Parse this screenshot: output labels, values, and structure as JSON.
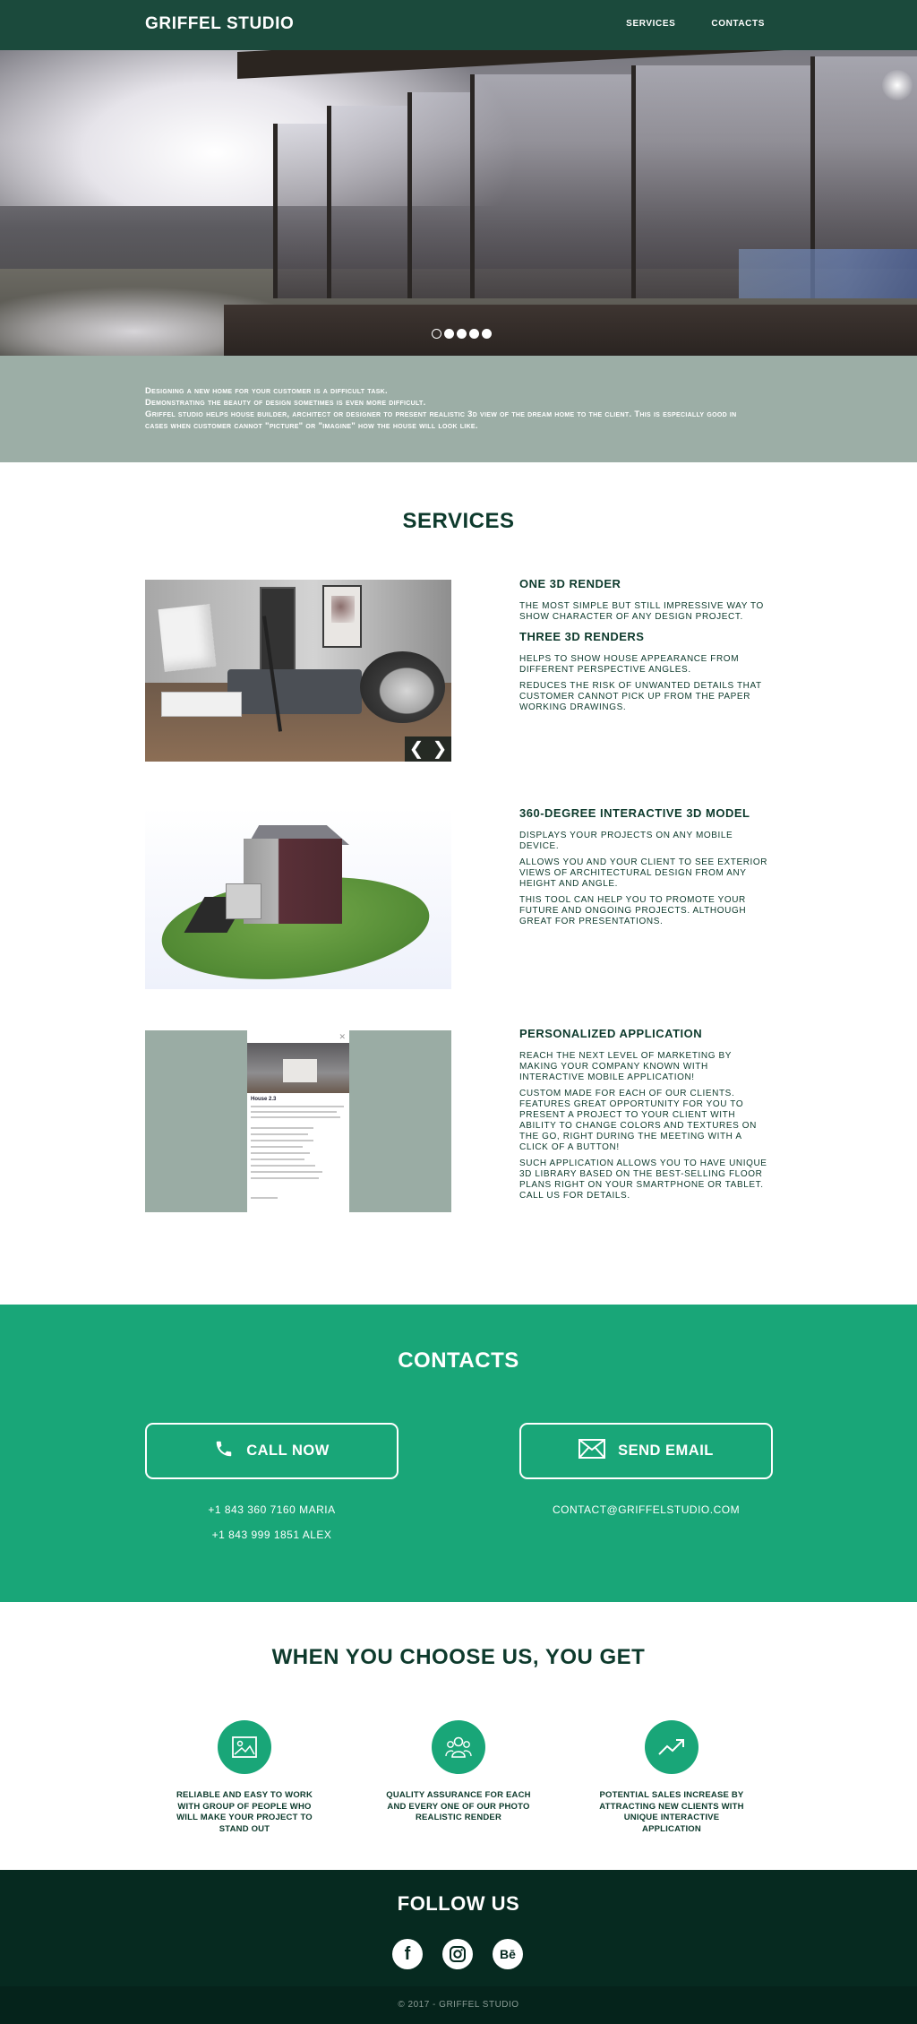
{
  "header": {
    "brand": "GRIFFEL STUDIO",
    "nav": [
      "SERVICES",
      "CONTACTS"
    ]
  },
  "hero": {
    "slides": 5,
    "active_slide": 1
  },
  "intro": {
    "lines": [
      "Designing a new home for your customer is a difficult task.",
      "Demonstrating the beauty of design sometimes is even more difficult.",
      "Griffel studio helps house builder, architect or designer to present realistic 3d view of the dream home to the client. This is especially good in cases when customer cannot \"picture\" or \"imagine\" how the house will look like."
    ]
  },
  "services": {
    "title": "SERVICES",
    "items": [
      {
        "heading": "ONE 3D RENDER",
        "paragraphs": [
          "The most simple but still impressive way to show character of any design project."
        ],
        "heading2": "THREE 3D RENDERS",
        "paragraphs2": [
          "Helps to show house appearance from different perspective angles.",
          "Reduces the risk of unwanted details that customer cannot pick up from the paper working drawings."
        ]
      },
      {
        "heading": "360-DEGREE INTERACTIVE 3D MODEL",
        "paragraphs": [
          "Displays your projects on any mobile device.",
          "Allows you and your client to see exterior views of architectural design from any height and angle.",
          "This tool can help you to promote your future and ongoing projects. Although great for presentations."
        ]
      },
      {
        "heading": "PERSONALIZED APPLICATION",
        "paragraphs": [
          "Reach the next level of marketing by making your company known with interactive mobile application!",
          "Custom made for each of our clients. Features great opportunity for you to present a project to your client with ability to change colors and textures on the go, right during the meeting with a click of a button!",
          "Such application allows you to have unique 3D library based on the best-selling floor plans right on your smartphone or tablet. Call us for details."
        ],
        "app_title": "House 2.3"
      }
    ],
    "slider_arrows": [
      "❮",
      "❯"
    ]
  },
  "contacts": {
    "title": "CONTACTS",
    "call_label": "CALL NOW",
    "email_label": "SEND EMAIL",
    "phones": [
      "+1 843 360 7160 MARIA",
      "+1 843 999 1851 ALEX"
    ],
    "email": "CONTACT@GRIFFELSTUDIO.COM"
  },
  "why": {
    "title": "WHEN YOU CHOOSE US, YOU GET",
    "features": [
      {
        "icon": "image-icon",
        "text": "RELIABLE AND EASY TO WORK WITH GROUP OF PEOPLE WHO WILL MAKE YOUR PROJECT TO STAND OUT"
      },
      {
        "icon": "team-icon",
        "text": "QUALITY ASSURANCE FOR EACH AND EVERY ONE OF OUR PHOTO REALISTIC RENDER"
      },
      {
        "icon": "trend-up-icon",
        "text": "POTENTIAL SALES INCREASE BY ATTRACTING NEW CLIENTS WITH UNIQUE INTERACTIVE APPLICATION"
      }
    ]
  },
  "follow": {
    "title": "FOLLOW US",
    "socials": [
      "facebook-icon",
      "instagram-icon",
      "behance-icon"
    ],
    "behance_text": "Bē",
    "facebook_text": "f"
  },
  "footer": {
    "text": "© 2017 - GRIFFEL STUDIO"
  },
  "colors": {
    "header": "#1b4a3c",
    "accent_green": "#19a678",
    "intro_bg": "#9caea6",
    "dark": "#062a20"
  }
}
